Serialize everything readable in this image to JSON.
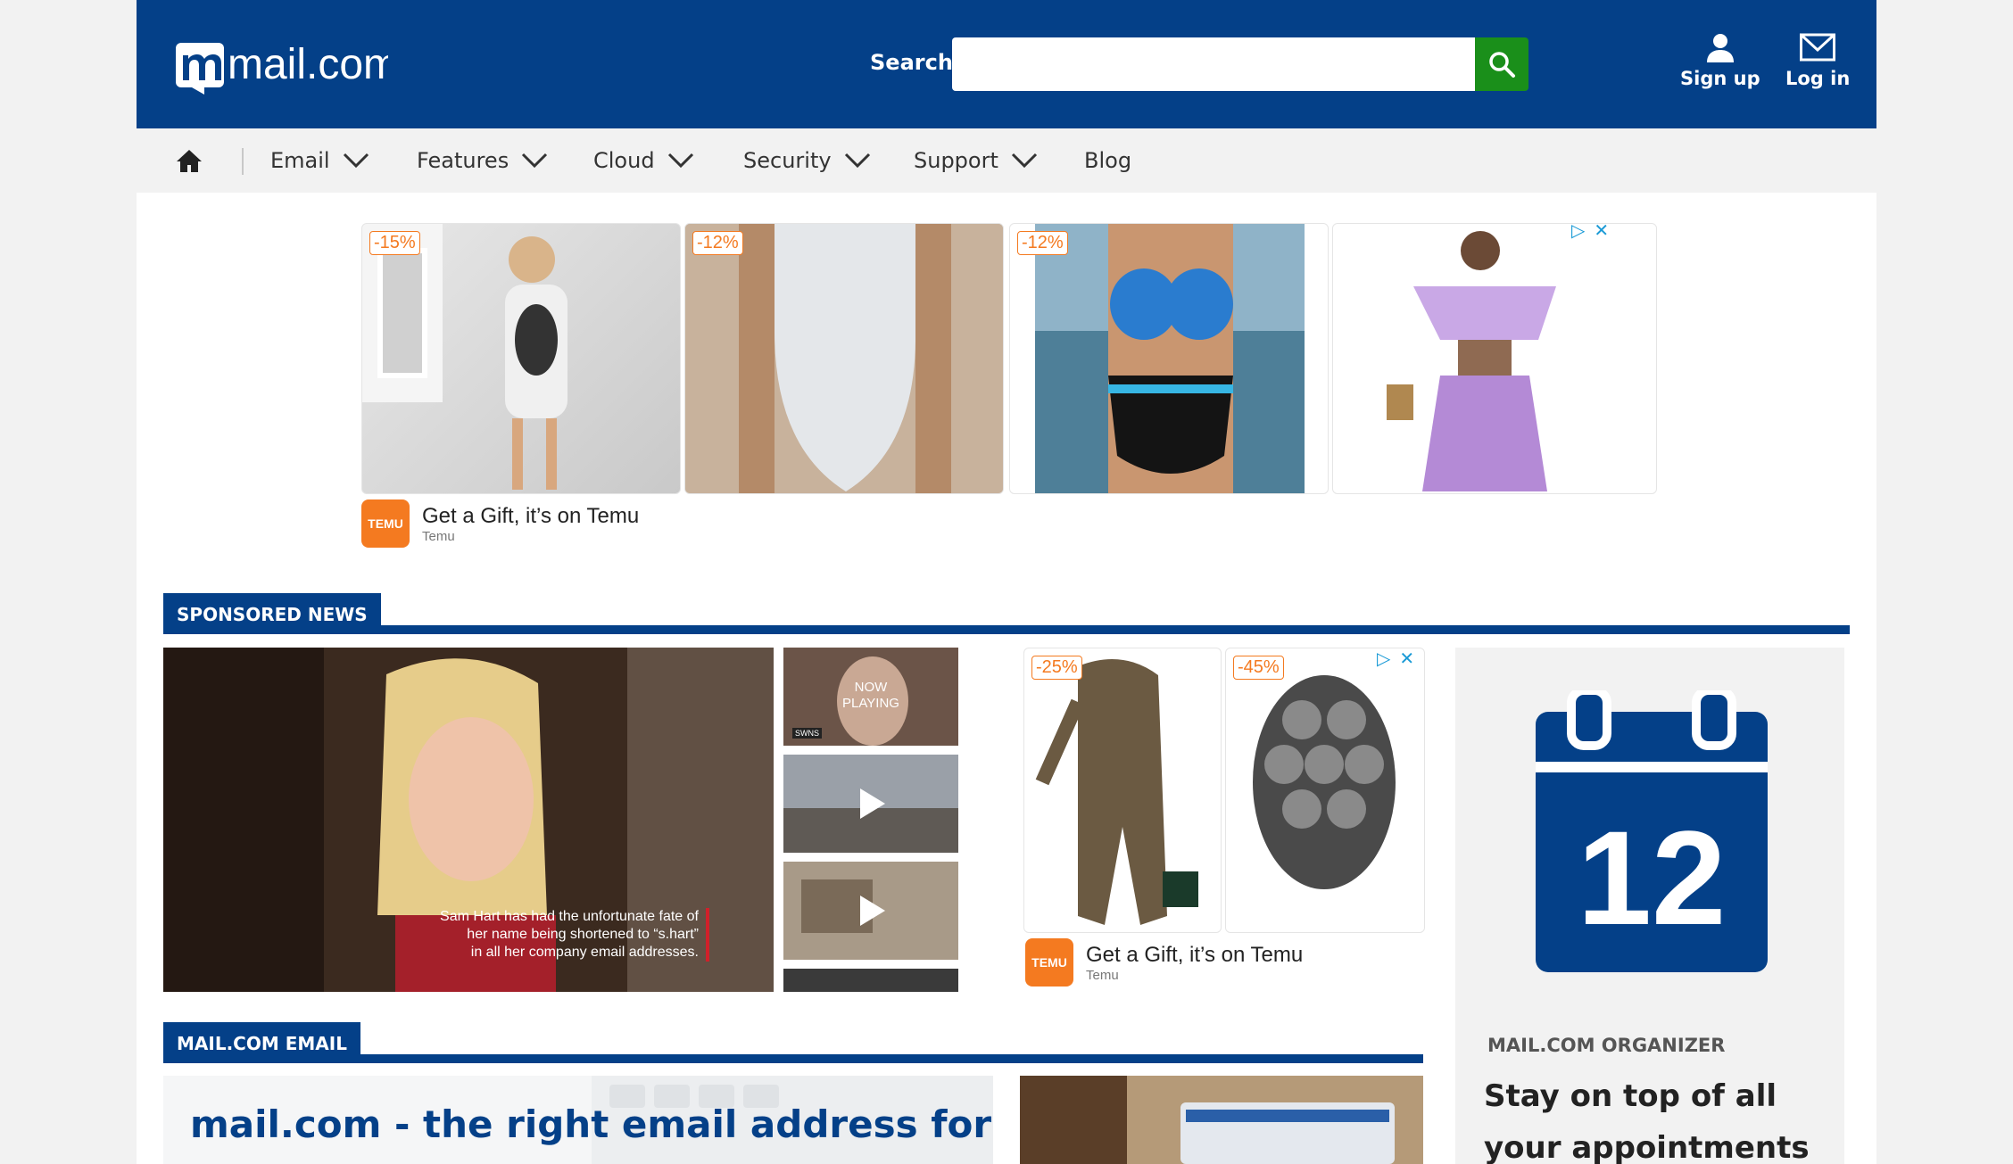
{
  "header": {
    "logo_text": "mail.com",
    "search_label": "Search",
    "search_placeholder": "",
    "signup_label": "Sign up",
    "login_label": "Log in"
  },
  "nav": {
    "items": [
      {
        "label": "Email",
        "has_dropdown": true
      },
      {
        "label": "Features",
        "has_dropdown": true
      },
      {
        "label": "Cloud",
        "has_dropdown": true
      },
      {
        "label": "Security",
        "has_dropdown": true
      },
      {
        "label": "Support",
        "has_dropdown": true
      },
      {
        "label": "Blog",
        "has_dropdown": false
      }
    ]
  },
  "ad_top": {
    "discounts": [
      "-15%",
      "-12%",
      "-12%"
    ],
    "logo_text": "TEMU",
    "title": "Get a Gift, it’s on Temu",
    "advertiser": "Temu"
  },
  "sponsored_news": {
    "heading": "SPONSORED NEWS",
    "video_caption": [
      "Sam Hart has had the unfortunate fate of",
      "her name being shortened to “s.hart”",
      "in all her company email addresses."
    ],
    "now_playing": [
      "NOW",
      "PLAYING"
    ],
    "thumb1_brand": "SWNS"
  },
  "ad_mid": {
    "discounts": [
      "-25%",
      "-45%"
    ],
    "logo_text": "TEMU",
    "title": "Get a Gift, it’s on Temu",
    "advertiser": "Temu"
  },
  "organizer": {
    "calendar_day": "12",
    "label": "MAIL.COM ORGANIZER",
    "headline": "Stay on top of all your appointments"
  },
  "email_section": {
    "heading": "MAIL.COM EMAIL",
    "card_title": "mail.com - the right email address for you"
  },
  "colors": {
    "brand_blue": "#044088",
    "search_green": "#1a8f1a",
    "temu_orange": "#f47a20"
  }
}
